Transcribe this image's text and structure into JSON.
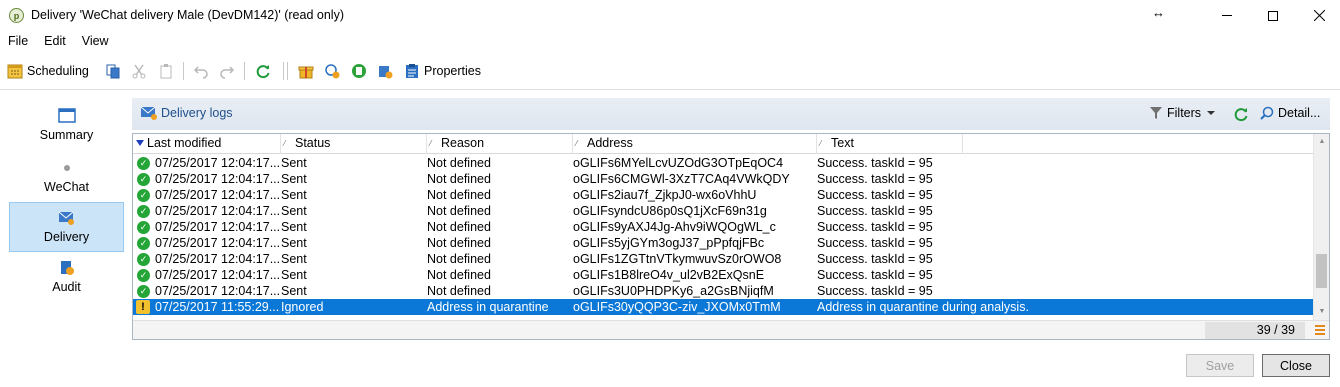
{
  "window": {
    "title": "Delivery 'WeChat delivery Male (DevDM142)' (read only)",
    "icon_letter": "p"
  },
  "menu": [
    "File",
    "Edit",
    "View"
  ],
  "toolbar": {
    "scheduling_label": "Scheduling",
    "properties_label": "Properties"
  },
  "nav": [
    {
      "label": "Summary",
      "icon": "summary-icon",
      "selected": false
    },
    {
      "label": "WeChat",
      "icon": "dot-icon",
      "selected": false
    },
    {
      "label": "Delivery",
      "icon": "delivery-icon",
      "selected": true
    },
    {
      "label": "Audit",
      "icon": "audit-icon",
      "selected": false
    }
  ],
  "panel": {
    "title": "Delivery logs",
    "filters_label": "Filters",
    "detail_label": "Detail..."
  },
  "grid": {
    "columns": [
      "Last modified",
      "Status",
      "Reason",
      "Address",
      "Text"
    ],
    "rows": [
      {
        "status_icon": "ok",
        "modified": "07/25/2017 12:04:17...",
        "status": "Sent",
        "reason": "Not defined",
        "address": "oGLIFs6MYelLcvUZOdG3OTpEqOC4",
        "text": "Success. taskId = 95"
      },
      {
        "status_icon": "ok",
        "modified": "07/25/2017 12:04:17...",
        "status": "Sent",
        "reason": "Not defined",
        "address": "oGLIFs6CMGWl-3XzT7CAq4VWkQDY",
        "text": "Success. taskId = 95"
      },
      {
        "status_icon": "ok",
        "modified": "07/25/2017 12:04:17...",
        "status": "Sent",
        "reason": "Not defined",
        "address": "oGLIFs2iau7f_ZjkpJ0-wx6oVhhU",
        "text": "Success. taskId = 95"
      },
      {
        "status_icon": "ok",
        "modified": "07/25/2017 12:04:17...",
        "status": "Sent",
        "reason": "Not defined",
        "address": "oGLIFsyndcU86p0sQ1jXcF69n31g",
        "text": "Success. taskId = 95"
      },
      {
        "status_icon": "ok",
        "modified": "07/25/2017 12:04:17...",
        "status": "Sent",
        "reason": "Not defined",
        "address": "oGLIFs9yAXJ4Jg-Ahv9iWQOgWL_c",
        "text": "Success. taskId = 95"
      },
      {
        "status_icon": "ok",
        "modified": "07/25/2017 12:04:17...",
        "status": "Sent",
        "reason": "Not defined",
        "address": "oGLIFs5yjGYm3ogJ37_pPpfqjFBc",
        "text": "Success. taskId = 95"
      },
      {
        "status_icon": "ok",
        "modified": "07/25/2017 12:04:17...",
        "status": "Sent",
        "reason": "Not defined",
        "address": "oGLIFs1ZGTtnVTkymwuvSz0rOWO8",
        "text": "Success. taskId = 95"
      },
      {
        "status_icon": "ok",
        "modified": "07/25/2017 12:04:17...",
        "status": "Sent",
        "reason": "Not defined",
        "address": "oGLIFs1B8lreO4v_ul2vB2ExQsnE",
        "text": "Success. taskId = 95"
      },
      {
        "status_icon": "ok",
        "modified": "07/25/2017 12:04:17...",
        "status": "Sent",
        "reason": "Not defined",
        "address": "oGLIFs3U0PHDPKy6_a2GsBNjiqfM",
        "text": "Success. taskId = 95"
      },
      {
        "status_icon": "warn",
        "modified": "07/25/2017 11:55:29...",
        "status": "Ignored",
        "reason": "Address in quarantine",
        "address": "oGLIFs30yQQP3C-ziv_JXOMx0TmM",
        "text": "Address in quarantine during analysis.",
        "selected": true
      }
    ],
    "count": "39 / 39"
  },
  "buttons": {
    "save": "Save",
    "close": "Close"
  },
  "colors": {
    "selection": "#0b78d7",
    "ok": "#23a537",
    "warning": "#f2c12e",
    "nav_selected": "#cce4f7"
  }
}
